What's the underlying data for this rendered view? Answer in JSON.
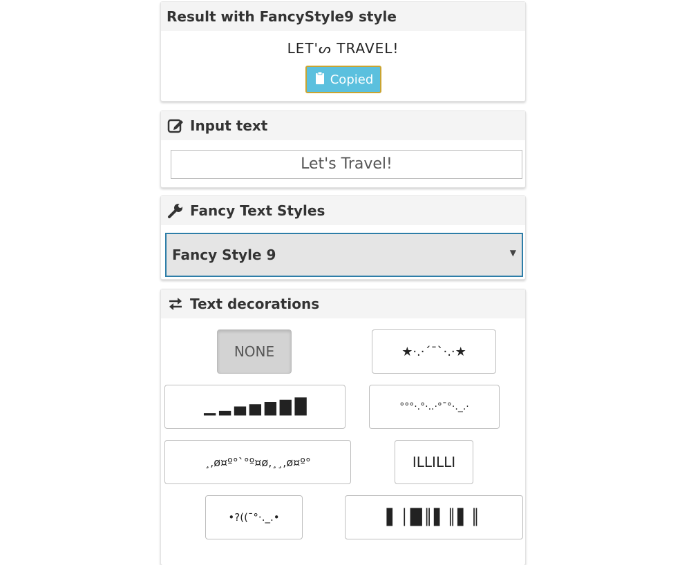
{
  "result": {
    "heading": "Result with FancyStyle9 style",
    "text": "LET'ᔕ TRAVEL!",
    "copy_label": "Copied"
  },
  "input": {
    "heading": "Input text",
    "value": "Let's Travel!"
  },
  "styles": {
    "heading": "Fancy Text Styles",
    "selected": "Fancy Style 9"
  },
  "decorations": {
    "heading": "Text decorations",
    "items": [
      "NONE",
      "★·.·´¯`·.·★",
      "▁ ▂ ▄ ▅ ▆ ▇ █",
      "°°°·.°·..·°¯°·._.·",
      "¸,ø¤º°`°º¤ø,¸¸,ø¤º°",
      "ILLILLI",
      "•?((¯°·._.•",
      "▌│█║▌║▌║"
    ]
  },
  "colors": {
    "accent_border": "#2e7ea8",
    "copy_button": "#5bc0de"
  }
}
